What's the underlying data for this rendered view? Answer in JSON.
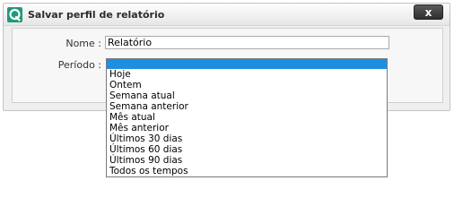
{
  "dialog": {
    "title": "Salvar perfil de relatório",
    "close_label": "x"
  },
  "form": {
    "name_label": "Nome :",
    "name_value": "Relatório",
    "period_label": "Período :",
    "period_selected": ""
  },
  "period_options": [
    "Hoje",
    "Ontem",
    "Semana atual",
    "Semana anterior",
    "Mês atual",
    "Mês anterior",
    "Últimos 30 dias",
    "Últimos 60 dias",
    "Últimos 90 dias",
    "Todos os tempos"
  ],
  "icons": {
    "app": "app-logo-icon",
    "close": "close-icon"
  },
  "colors": {
    "app_icon": "#1f9a7a",
    "selection": "#1e8fe0",
    "close_button": "#3a3a3a"
  }
}
